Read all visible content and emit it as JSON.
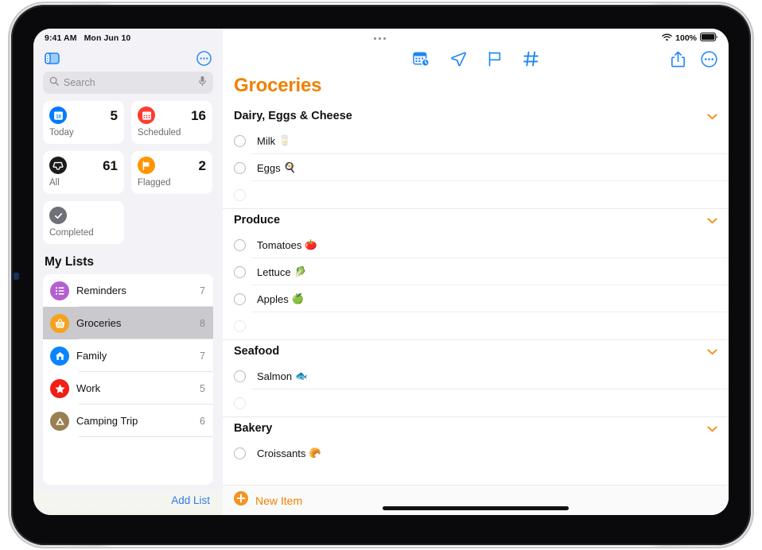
{
  "statusbar": {
    "time": "9:41 AM",
    "date": "Mon Jun 10",
    "wifi_icon": "wifi-icon",
    "battery_percent": "100%",
    "battery_icon": "battery-full-icon"
  },
  "sidebar": {
    "toggle_sidebar_icon": "sidebar-toggle-icon",
    "more_icon": "ellipsis-circle-icon",
    "search": {
      "placeholder": "Search",
      "search_icon": "search-icon",
      "mic_icon": "microphone-icon"
    },
    "smart_lists": [
      {
        "label": "Today",
        "count": "5",
        "icon": "calendar-today-icon",
        "color": "#007aff",
        "badge_text": "10"
      },
      {
        "label": "Scheduled",
        "count": "16",
        "icon": "calendar-icon",
        "color": "#ff3b30",
        "badge_text": ""
      },
      {
        "label": "All",
        "count": "61",
        "icon": "inbox-tray-icon",
        "color": "#1c1c1e",
        "badge_text": ""
      },
      {
        "label": "Flagged",
        "count": "2",
        "icon": "flag-icon",
        "color": "#ff9500",
        "badge_text": ""
      },
      {
        "label": "Completed",
        "count": "",
        "icon": "checkmark-icon",
        "color": "#6e7177",
        "badge_text": ""
      }
    ],
    "my_lists_heading": "My Lists",
    "lists": [
      {
        "name": "Reminders",
        "count": "7",
        "icon": "bulleted-list-icon",
        "color": "#b45fd0",
        "selected": false
      },
      {
        "name": "Groceries",
        "count": "8",
        "icon": "basket-icon",
        "color": "#f6a21c",
        "selected": true
      },
      {
        "name": "Family",
        "count": "7",
        "icon": "house-icon",
        "color": "#0a84ff",
        "selected": false
      },
      {
        "name": "Work",
        "count": "5",
        "icon": "star-icon",
        "color": "#f01f16",
        "selected": false
      },
      {
        "name": "Camping Trip",
        "count": "6",
        "icon": "tent-icon",
        "color": "#9a7f53",
        "selected": false
      }
    ],
    "add_list_label": "Add List"
  },
  "main": {
    "grabber_icon": "window-grabber-icon",
    "toolbar": {
      "center_icons": [
        {
          "name": "add-date-icon",
          "glyph": "calendar-clock-icon"
        },
        {
          "name": "add-location-icon",
          "glyph": "location-arrow-icon"
        },
        {
          "name": "add-flag-icon",
          "glyph": "flag-outline-icon"
        },
        {
          "name": "add-tag-icon",
          "glyph": "hashtag-icon"
        }
      ],
      "right_icons": [
        {
          "name": "share-button",
          "glyph": "share-icon"
        },
        {
          "name": "more-button",
          "glyph": "ellipsis-circle-icon"
        }
      ]
    },
    "title": "Groceries",
    "title_color": "#f08000",
    "sections": [
      {
        "title": "Dairy, Eggs & Cheese",
        "collapse_icon": "chevron-down-icon",
        "items": [
          {
            "text": "Milk",
            "emoji": "🥛",
            "empty": false
          },
          {
            "text": "Eggs",
            "emoji": "🍳",
            "empty": false
          },
          {
            "text": "",
            "emoji": "",
            "empty": true
          }
        ]
      },
      {
        "title": "Produce",
        "collapse_icon": "chevron-down-icon",
        "items": [
          {
            "text": "Tomatoes",
            "emoji": "🍅",
            "empty": false
          },
          {
            "text": "Lettuce",
            "emoji": "🥬",
            "empty": false
          },
          {
            "text": "Apples",
            "emoji": "🍏",
            "empty": false
          },
          {
            "text": "",
            "emoji": "",
            "empty": true
          }
        ]
      },
      {
        "title": "Seafood",
        "collapse_icon": "chevron-down-icon",
        "items": [
          {
            "text": "Salmon",
            "emoji": "🐟",
            "empty": false
          },
          {
            "text": "",
            "emoji": "",
            "empty": true
          }
        ]
      },
      {
        "title": "Bakery",
        "collapse_icon": "chevron-down-icon",
        "items": [
          {
            "text": "Croissants",
            "emoji": "🥐",
            "empty": false
          }
        ]
      }
    ],
    "new_item_label": "New Item",
    "new_item_icon": "plus-circle-icon"
  }
}
